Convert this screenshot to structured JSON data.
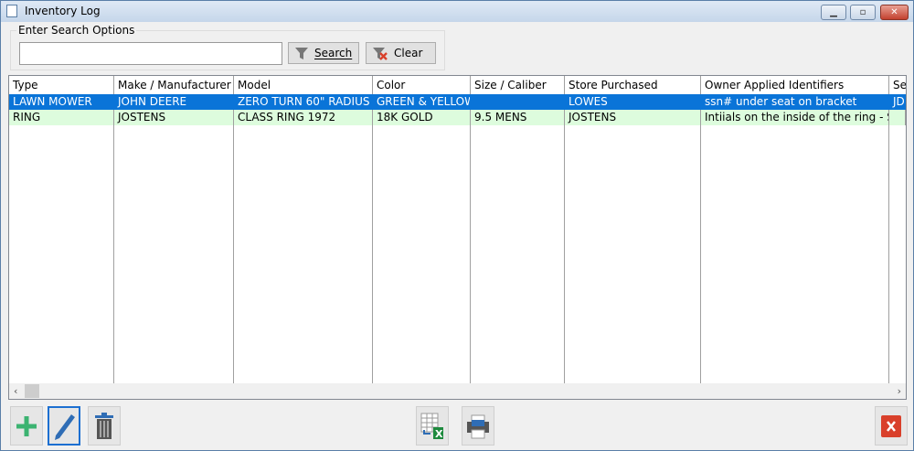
{
  "window": {
    "title": "Inventory Log",
    "minimize": "▁",
    "restore": "▫",
    "close": "✕"
  },
  "search": {
    "group_label": "Enter Search Options",
    "value": "",
    "placeholder": "",
    "search_label": "Search",
    "clear_label": "Clear"
  },
  "table": {
    "columns": [
      "Type",
      "Make / Manufacturer",
      "Model",
      "Color",
      "Size / Caliber",
      "Store Purchased",
      "Owner Applied Identifiers",
      "Se"
    ],
    "rows": [
      [
        "LAWN MOWER",
        "JOHN DEERE",
        "ZERO TURN 60\" RADIUS",
        "GREEN & YELLOW",
        "",
        "LOWES",
        "ssn# under seat on bracket",
        "JD"
      ],
      [
        "RING",
        "JOSTENS",
        "CLASS RING 1972",
        "18K GOLD",
        "9.5 MENS",
        "JOSTENS",
        "Intiials on the inside of the ring - S.C",
        ""
      ]
    ],
    "selected_row": 0
  },
  "toolbar": {
    "add_icon": "plus-icon",
    "edit_icon": "pencil-icon",
    "delete_icon": "trash-icon",
    "export_icon": "excel-export-icon",
    "print_icon": "printer-icon",
    "close_icon": "close-icon"
  },
  "colors": {
    "selection": "#0a74d8",
    "alt_row": "#ddfcdd",
    "add": "#3cb371",
    "close": "#d9402b"
  }
}
